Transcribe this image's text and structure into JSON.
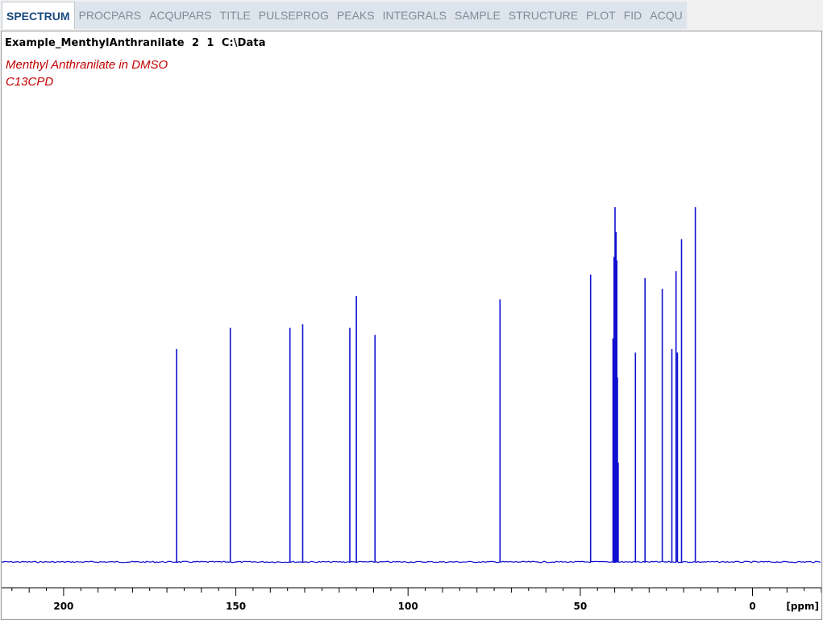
{
  "tabs": [
    {
      "label": "SPECTRUM",
      "active": true
    },
    {
      "label": "PROCPARS",
      "active": false
    },
    {
      "label": "ACQUPARS",
      "active": false
    },
    {
      "label": "TITLE",
      "active": false
    },
    {
      "label": "PULSEPROG",
      "active": false
    },
    {
      "label": "PEAKS",
      "active": false
    },
    {
      "label": "INTEGRALS",
      "active": false
    },
    {
      "label": "SAMPLE",
      "active": false
    },
    {
      "label": "STRUCTURE",
      "active": false
    },
    {
      "label": "PLOT",
      "active": false
    },
    {
      "label": "FID",
      "active": false
    },
    {
      "label": "ACQU",
      "active": false
    }
  ],
  "dataset": {
    "name": "Example_MenthylAnthranilate",
    "expno": "2",
    "procno": "1",
    "dir": "C:\\Data"
  },
  "title_lines": [
    "Menthyl Anthranilate in DMSO",
    "C13CPD"
  ],
  "colors": {
    "spectrum": "#1010d0",
    "title_text": "#c00000",
    "active_tab_text": "#1a4a80",
    "inactive_tab_text": "#7f8c99",
    "tab_strip": "#dde4ec"
  },
  "chart_data": {
    "type": "line",
    "xlabel": "[ppm]",
    "xlim": [
      218,
      -20
    ],
    "x_reversed": true,
    "ticks": [
      200,
      150,
      100,
      50,
      0
    ],
    "minor_tick_step": 5,
    "ylim": [
      0,
      100
    ],
    "peaks": [
      {
        "ppm": 167.2,
        "height": 60
      },
      {
        "ppm": 151.6,
        "height": 66
      },
      {
        "ppm": 134.3,
        "height": 66
      },
      {
        "ppm": 130.6,
        "height": 67
      },
      {
        "ppm": 116.9,
        "height": 66
      },
      {
        "ppm": 115.0,
        "height": 75
      },
      {
        "ppm": 109.6,
        "height": 64
      },
      {
        "ppm": 73.3,
        "height": 74
      },
      {
        "ppm": 47.0,
        "height": 81
      },
      {
        "ppm": 40.5,
        "height": 63
      },
      {
        "ppm": 40.2,
        "height": 86
      },
      {
        "ppm": 39.9,
        "height": 100
      },
      {
        "ppm": 39.6,
        "height": 93
      },
      {
        "ppm": 39.4,
        "height": 85
      },
      {
        "ppm": 39.2,
        "height": 52
      },
      {
        "ppm": 39.0,
        "height": 28
      },
      {
        "ppm": 34.0,
        "height": 59
      },
      {
        "ppm": 31.2,
        "height": 80
      },
      {
        "ppm": 26.2,
        "height": 77
      },
      {
        "ppm": 23.4,
        "height": 60
      },
      {
        "ppm": 22.2,
        "height": 82
      },
      {
        "ppm": 21.8,
        "height": 59
      },
      {
        "ppm": 20.6,
        "height": 91
      },
      {
        "ppm": 16.6,
        "height": 100
      }
    ]
  }
}
